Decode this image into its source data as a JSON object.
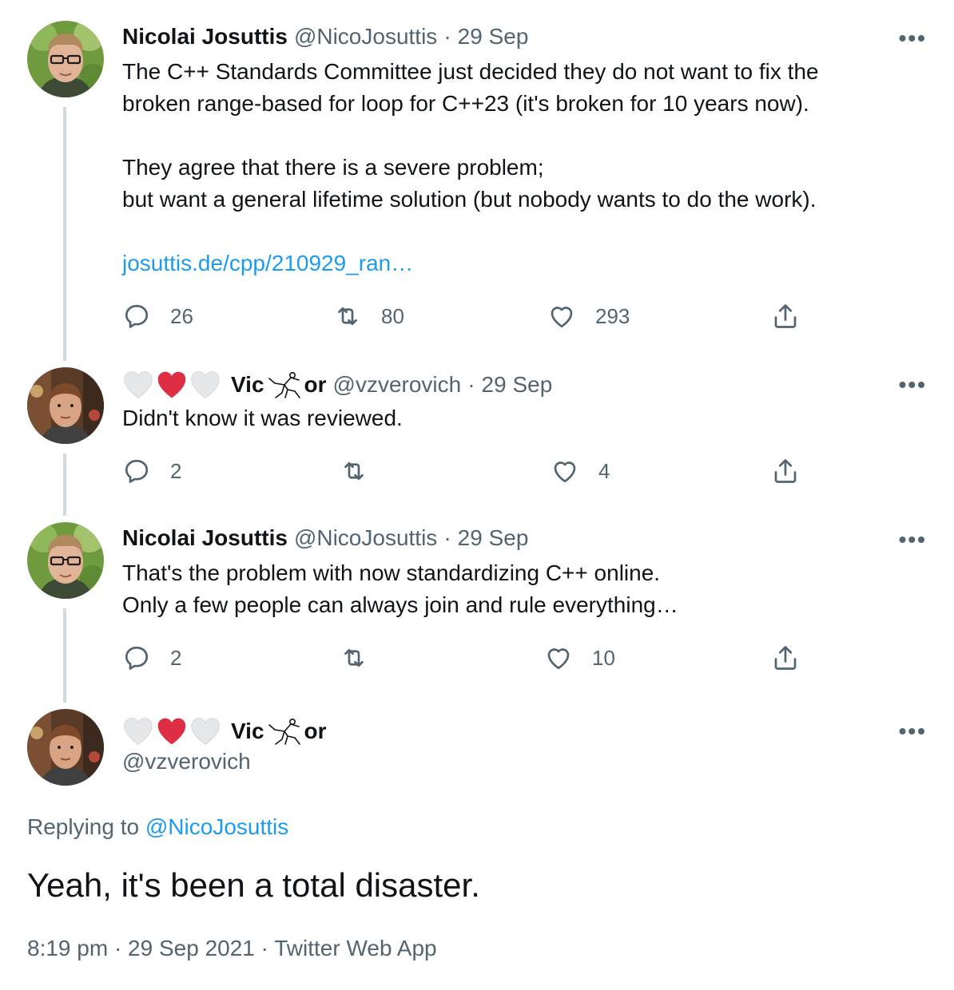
{
  "colors": {
    "link": "#1d9bf0",
    "secondary": "#536471",
    "primary": "#0f1419",
    "heart_red": "#e0245e",
    "thread_line": "#cfd9de"
  },
  "tweets": [
    {
      "name": "Nicolai Josuttis",
      "handle": "@NicoJosuttis",
      "date": "29 Sep",
      "text": "The C++ Standards Committee just decided they do not want to fix the\nbroken range-based for loop for C++23 (it's broken for 10 years now).\n\nThey agree that there is a severe problem;\nbut want a general lifetime solution (but nobody wants to do the work).",
      "link": "josuttis.de/cpp/210929_ran…",
      "replies": "26",
      "retweets": "80",
      "likes": "293"
    },
    {
      "name_prefix": "Vic",
      "name_suffix": "or",
      "handle": "@vzverovich",
      "date": "29 Sep",
      "text": "Didn't know it was reviewed.",
      "replies": "2",
      "retweets": "",
      "likes": "4"
    },
    {
      "name": "Nicolai Josuttis",
      "handle": "@NicoJosuttis",
      "date": "29 Sep",
      "text": "That's the problem with now standardizing C++ online.\nOnly a few people can always join and rule everything…",
      "replies": "2",
      "retweets": "",
      "likes": "10"
    }
  ],
  "main_tweet": {
    "name_prefix": "Vic",
    "name_suffix": "or",
    "handle": "@vzverovich",
    "replying_label": "Replying to",
    "replying_to": "@NicoJosuttis",
    "text": "Yeah, it's been a total disaster.",
    "meta": "8:19 pm · 29 Sep 2021 · Twitter Web App"
  },
  "common": {
    "dot": "·",
    "more": "•••"
  },
  "icons": [
    "reply-icon",
    "retweet-icon",
    "like-icon",
    "share-icon",
    "more-icon",
    "heart-white-icon",
    "heart-red-icon",
    "dancer-emoji-icon"
  ]
}
